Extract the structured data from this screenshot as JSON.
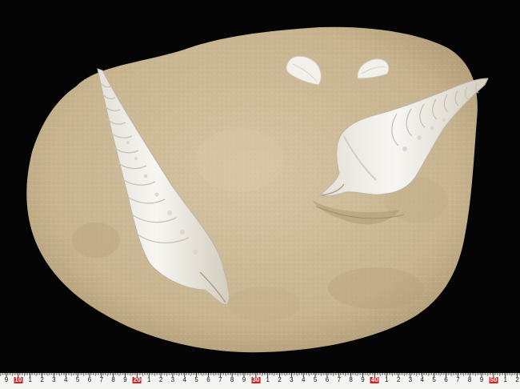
{
  "photo": {
    "subject": "fossil-gastropod-shells-in-sandstone-matrix",
    "colors": {
      "background": "#050505",
      "matrix": "#cdbb9a",
      "matrix_shadow": "#a8946f",
      "shell": "#f1efe9",
      "shell_shadow": "#cfc8bb",
      "ruler_bg": "#f4f4f2",
      "ruler_major": "#d21e1e"
    }
  },
  "ruler": {
    "labels": [
      "9",
      "10",
      "1",
      "2",
      "3",
      "4",
      "5",
      "6",
      "7",
      "8",
      "9",
      "20",
      "1",
      "2",
      "3",
      "4",
      "5",
      "6",
      "7",
      "8",
      "9",
      "30",
      "1",
      "2",
      "3",
      "4",
      "5",
      "6",
      "7",
      "8",
      "9",
      "40",
      "1",
      "2",
      "3",
      "4",
      "5",
      "6",
      "7",
      "8",
      "9",
      "50",
      "1",
      "2"
    ],
    "major_labels": [
      "10",
      "20",
      "30",
      "40",
      "50"
    ],
    "unit": "cm"
  }
}
